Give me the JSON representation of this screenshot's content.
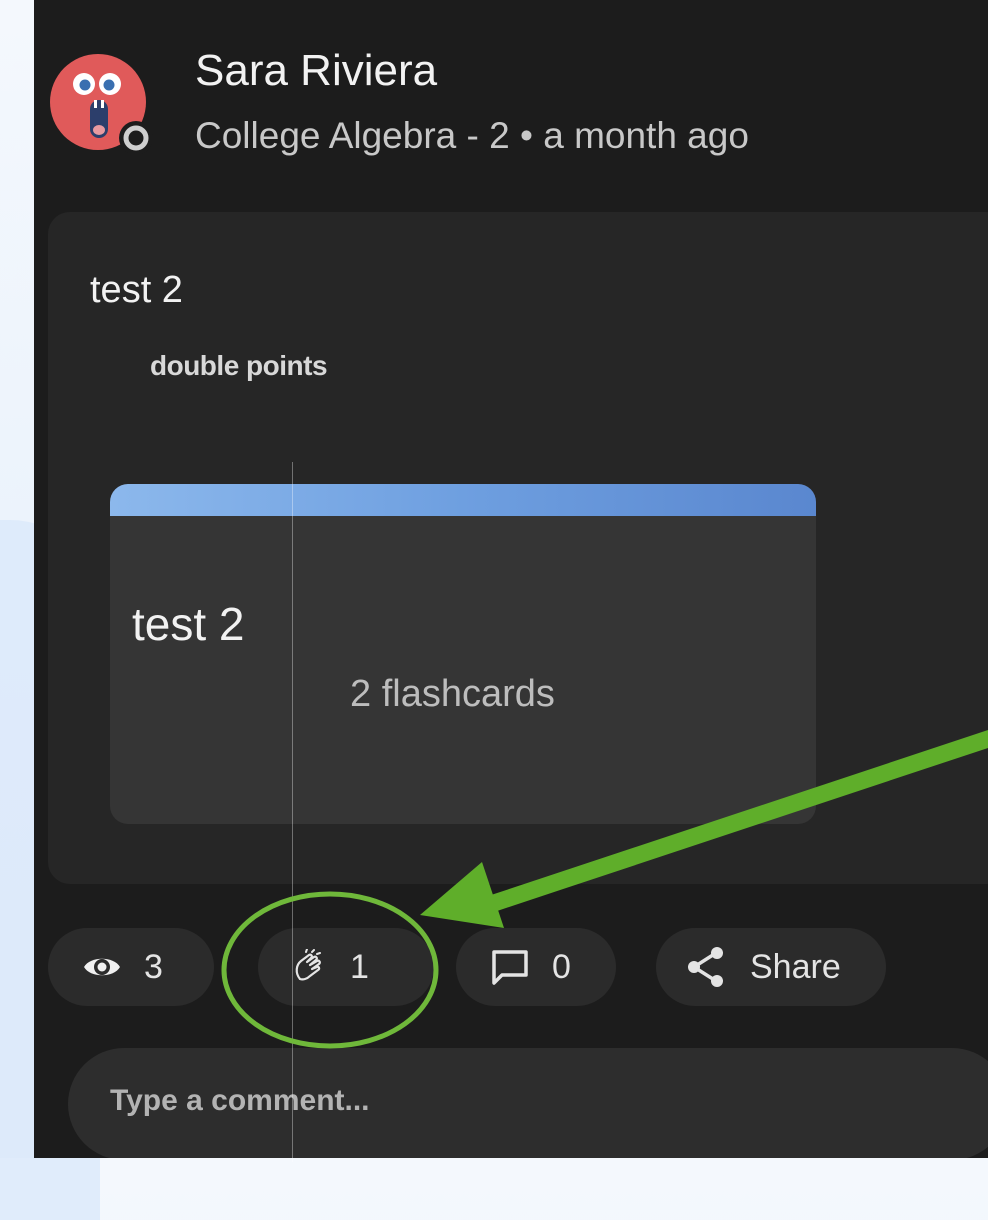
{
  "post": {
    "author": "Sara Riviera",
    "meta": "College Algebra - 2 • a month ago",
    "title": "test 2",
    "body": "double points"
  },
  "attached_set": {
    "title": "test 2",
    "count_label": "2 flashcards"
  },
  "actions": {
    "views": "3",
    "claps": "1",
    "comments": "0",
    "share_label": "Share"
  },
  "comment_box": {
    "placeholder": "Type a comment..."
  },
  "colors": {
    "panel_bg": "#1c1c1c",
    "card_bg": "#262626",
    "set_card_bg": "#353535",
    "set_card_bar": "#6e9fe0",
    "annotation_green": "#5fae2a",
    "avatar_red": "#e05a5a"
  },
  "icons": {
    "views": "eye-icon",
    "claps": "clapping-hands-icon",
    "comments": "comment-bubble-icon",
    "share": "share-icon",
    "avatar_badge": "status-badge-icon"
  }
}
